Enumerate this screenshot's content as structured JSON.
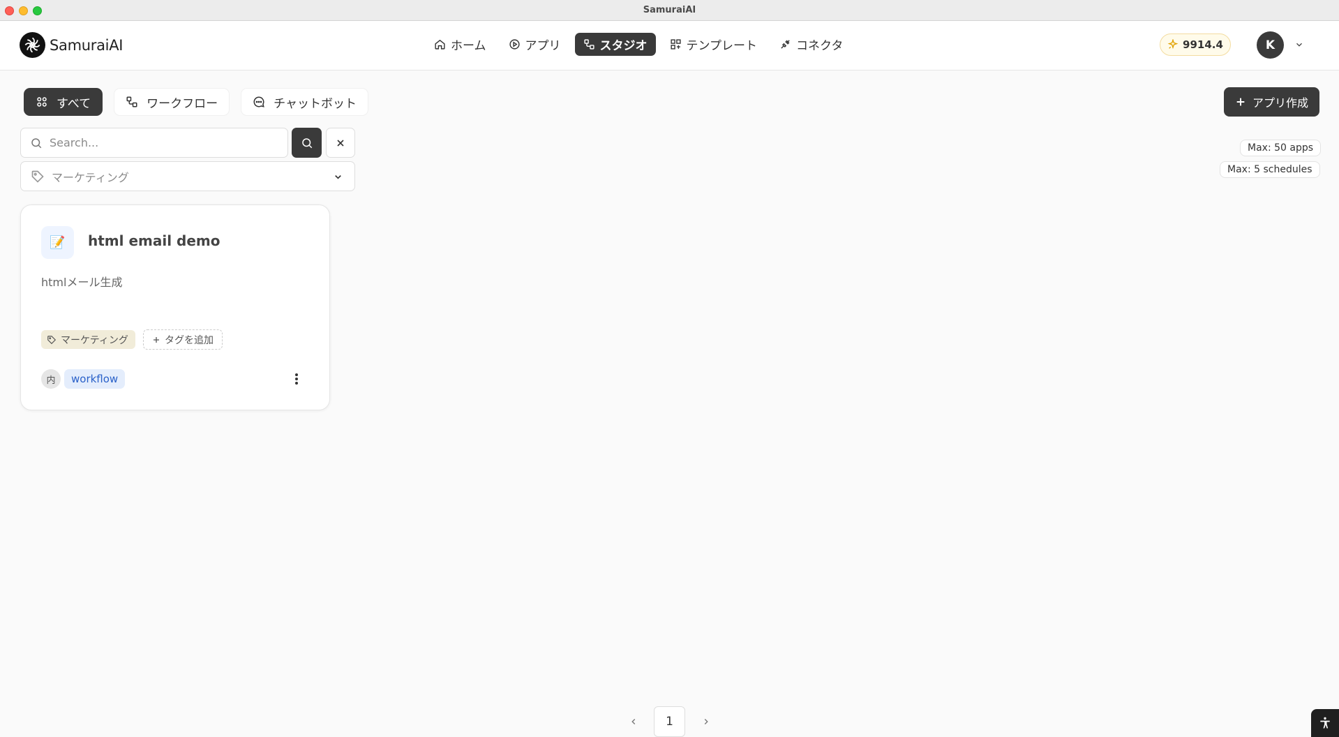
{
  "window": {
    "title": "SamuraiAI"
  },
  "brand": {
    "name": "SamuraiAI"
  },
  "nav": {
    "items": [
      {
        "label": "ホーム",
        "icon": "home-icon"
      },
      {
        "label": "アプリ",
        "icon": "play-circle-icon"
      },
      {
        "label": "スタジオ",
        "icon": "workflow-icon",
        "active": true
      },
      {
        "label": "テンプレート",
        "icon": "template-icon"
      },
      {
        "label": "コネクタ",
        "icon": "plug-icon"
      }
    ]
  },
  "header": {
    "credits": "9914.4",
    "avatar_initial": "K"
  },
  "filters": {
    "tabs": [
      {
        "label": "すべて",
        "icon": "grid-icon",
        "active": true
      },
      {
        "label": "ワークフロー",
        "icon": "workflow-icon"
      },
      {
        "label": "チャットボット",
        "icon": "chat-icon"
      }
    ]
  },
  "actions": {
    "create_app": "アプリ作成"
  },
  "search": {
    "placeholder": "Search...",
    "value": ""
  },
  "tag_filter": {
    "selected": "マーケティング"
  },
  "limits": {
    "apps": "Max: 50 apps",
    "schedules": "Max: 5 schedules"
  },
  "apps": [
    {
      "title": "html email demo",
      "description": "htmlメール生成",
      "tag": "マーケティング",
      "add_tag_label": "タグを追加",
      "owner_badge": "内",
      "type": "workflow"
    }
  ],
  "pagination": {
    "current": "1"
  },
  "colors": {
    "dark": "#3a3a3a",
    "accent_blue": "#2a61c9",
    "credit_bg": "#fffbea"
  }
}
